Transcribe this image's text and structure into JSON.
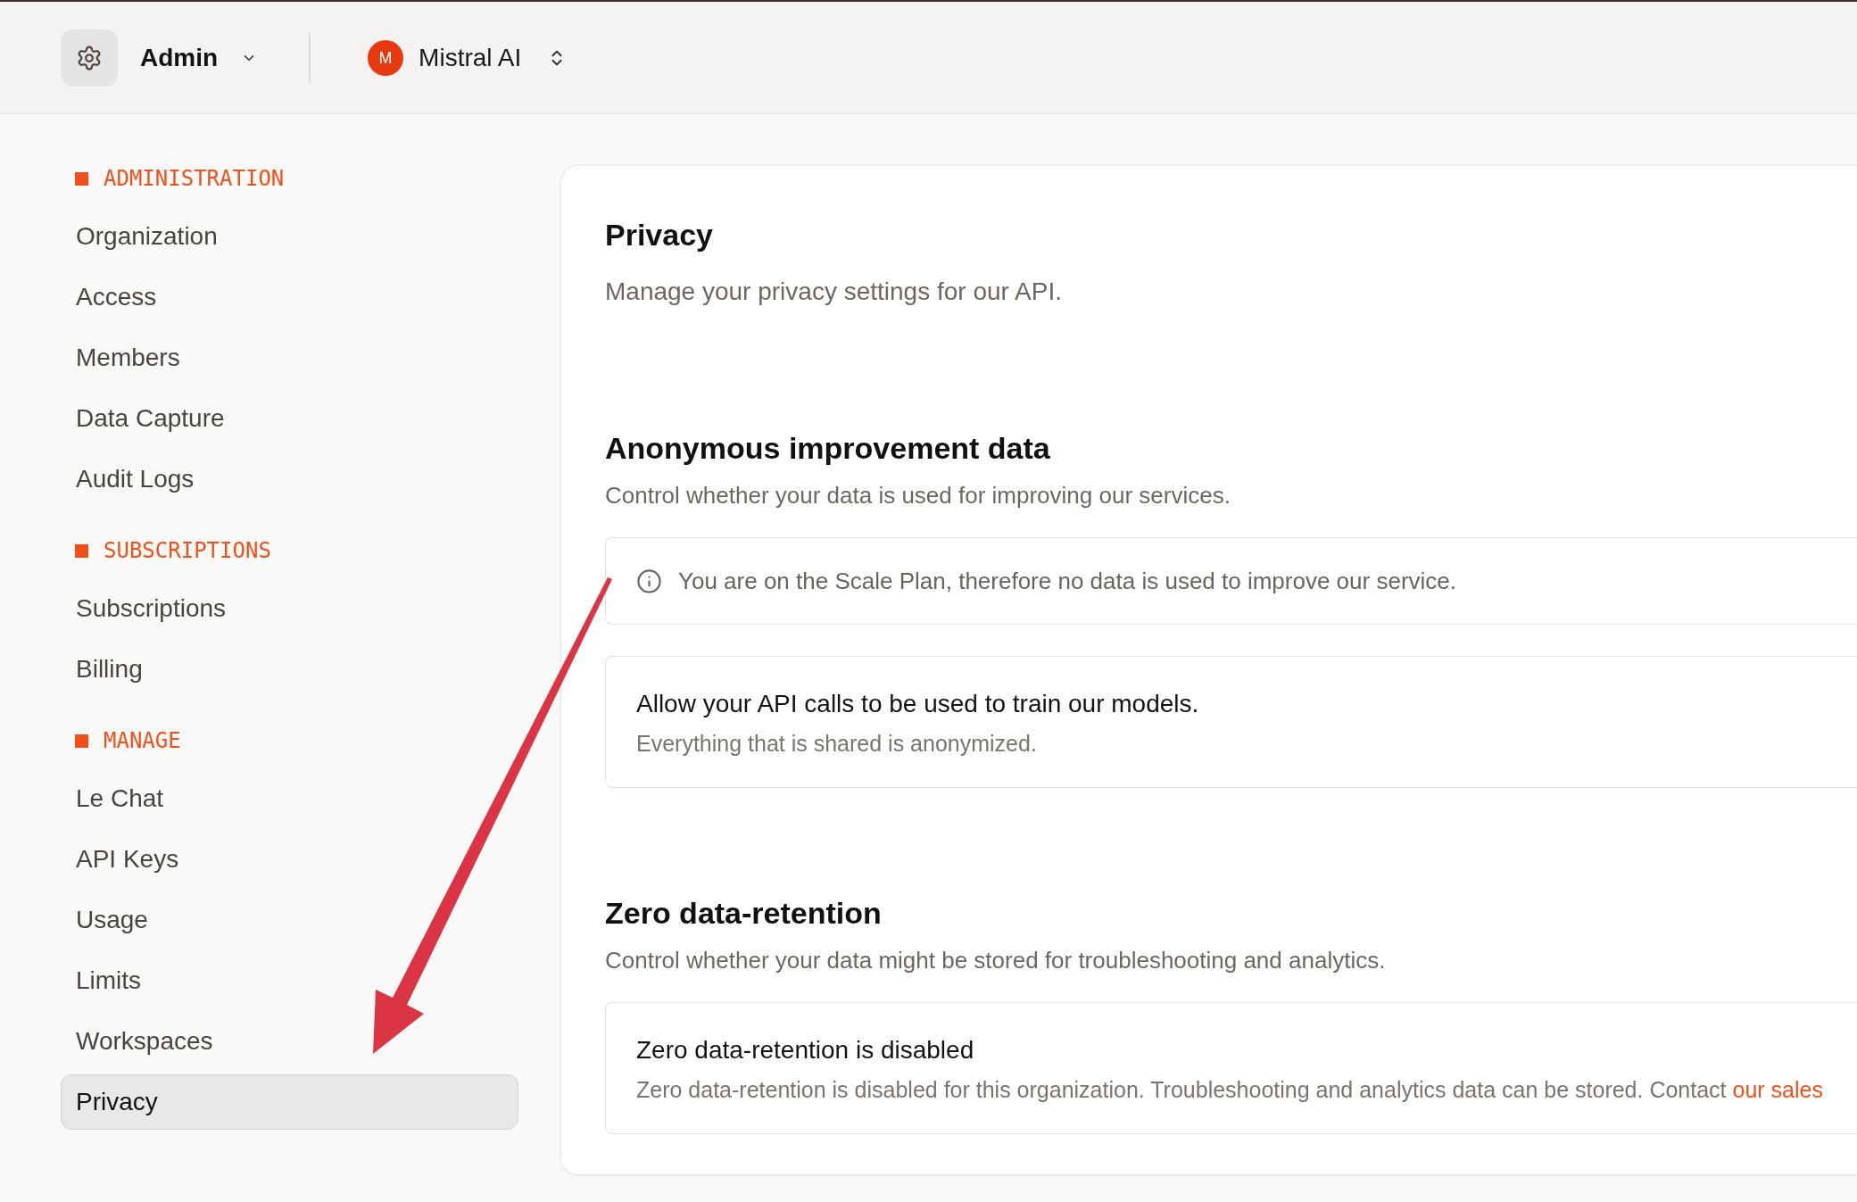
{
  "top_bar": {
    "workspace": {
      "label": "Admin"
    },
    "organization": {
      "initial": "M",
      "name": "Mistral AI"
    }
  },
  "sidebar": {
    "sections": [
      {
        "title": "ADMINISTRATION",
        "items": [
          {
            "label": "Organization",
            "selected": false
          },
          {
            "label": "Access",
            "selected": false
          },
          {
            "label": "Members",
            "selected": false
          },
          {
            "label": "Data Capture",
            "selected": false
          },
          {
            "label": "Audit Logs",
            "selected": false
          }
        ]
      },
      {
        "title": "SUBSCRIPTIONS",
        "items": [
          {
            "label": "Subscriptions",
            "selected": false
          },
          {
            "label": "Billing",
            "selected": false
          }
        ]
      },
      {
        "title": "MANAGE",
        "items": [
          {
            "label": "Le Chat",
            "selected": false
          },
          {
            "label": "API Keys",
            "selected": false
          },
          {
            "label": "Usage",
            "selected": false
          },
          {
            "label": "Limits",
            "selected": false
          },
          {
            "label": "Workspaces",
            "selected": false
          },
          {
            "label": "Privacy",
            "selected": true
          }
        ]
      }
    ]
  },
  "page": {
    "title": "Privacy",
    "subtitle": "Manage your privacy settings for our API."
  },
  "sections": [
    {
      "title": "Anonymous improvement data",
      "description": "Control whether your data is used for improving our services.",
      "panels": [
        {
          "kind": "notice",
          "text": "You are on the Scale Plan, therefore no data is used to improve our service."
        },
        {
          "kind": "setting",
          "title": "Allow your API calls to be used to train our models.",
          "description": "Everything that is shared is anonymized."
        }
      ]
    },
    {
      "title": "Zero data-retention",
      "description": "Control whether your data might be stored for troubleshooting and analytics.",
      "panels": [
        {
          "kind": "setting",
          "title": "Zero data-retention is disabled",
          "description": "Zero data-retention is disabled for this organization. Troubleshooting and analytics data can be stored. Contact",
          "link": "our sales"
        }
      ]
    }
  ]
}
